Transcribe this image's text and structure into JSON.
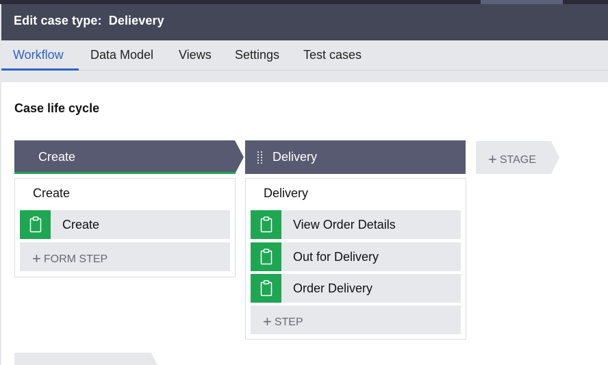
{
  "header": {
    "title": "Edit case type:  Delievery"
  },
  "tabs": [
    {
      "label": "Workflow",
      "active": true
    },
    {
      "label": "Data Model"
    },
    {
      "label": "Views"
    },
    {
      "label": "Settings"
    },
    {
      "label": "Test cases"
    }
  ],
  "main": {
    "title": "Case life cycle",
    "stages": [
      {
        "name": "Create",
        "process": "Create",
        "steps": [
          "Create"
        ],
        "add_step_label": "FORM STEP"
      },
      {
        "name": "Delivery",
        "process": "Delivery",
        "steps": [
          "View Order Details",
          "Out for Delivery",
          "Order Delivery"
        ],
        "add_step_label": "STEP"
      }
    ],
    "add_stage_label": "STAGE"
  },
  "colors": {
    "header_bg": "#434758",
    "active_tab": "#2b62c8",
    "stage_header": "#575a70",
    "selected_stage_underline": "#1fa653",
    "step_icon_bg": "#1fa653"
  },
  "icons": {
    "step": "clipboard-icon",
    "add": "plus-icon",
    "drag": "drag-handle-icon"
  }
}
